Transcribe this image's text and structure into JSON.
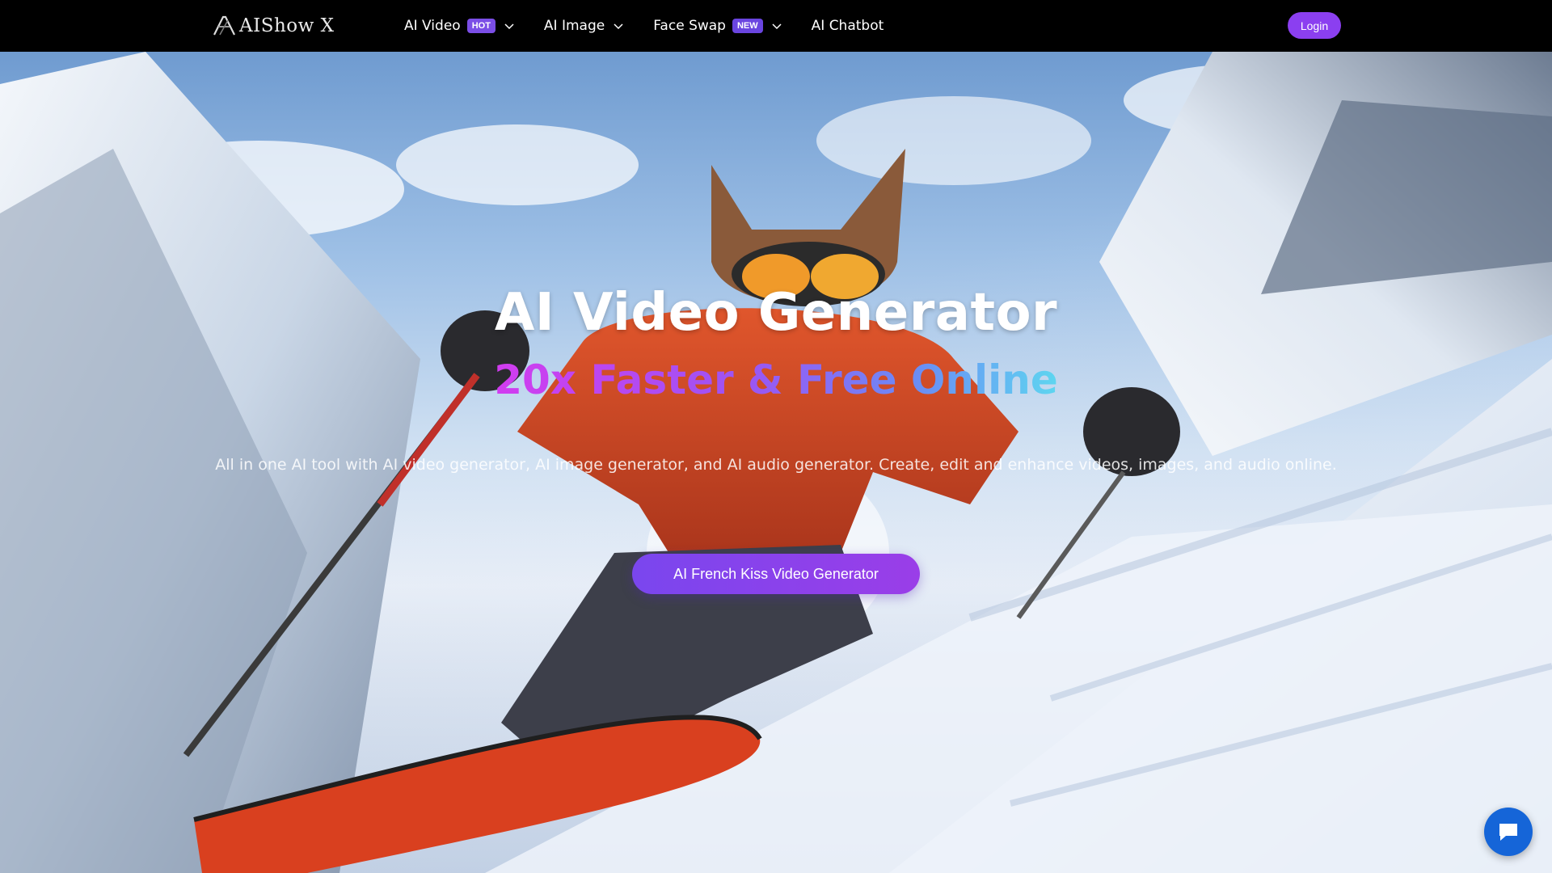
{
  "colors": {
    "nav_bg": "#000000",
    "accent_purple": "#8b3ff0",
    "hot_badge": "#7b4ee6",
    "new_badge": "#6a45e0",
    "cta_start": "#7a46ee",
    "cta_end": "#9a3ee8",
    "chat_button": "#1565d8"
  },
  "header": {
    "logo_text": "AIShow X",
    "nav": [
      {
        "label": "AI Video",
        "badge": "HOT",
        "has_dropdown": true,
        "icon": "chevron-down-icon"
      },
      {
        "label": "AI Image",
        "badge": "",
        "has_dropdown": true,
        "icon": "chevron-down-icon"
      },
      {
        "label": "Face Swap",
        "badge": "NEW",
        "has_dropdown": true,
        "icon": "chevron-down-icon"
      },
      {
        "label": "AI Chatbot",
        "badge": "",
        "has_dropdown": false,
        "icon": ""
      }
    ],
    "login_label": "Login"
  },
  "hero": {
    "title": "AI Video Generator",
    "subtitle": "20x Faster & Free Online",
    "description": "All in one AI tool with AI video generator, AI image generator, and AI audio generator. Create, edit and enhance videos, images, and audio online.",
    "cta_label": "AI French Kiss Video Generator"
  },
  "chat": {
    "icon": "chat-bubble-icon"
  }
}
